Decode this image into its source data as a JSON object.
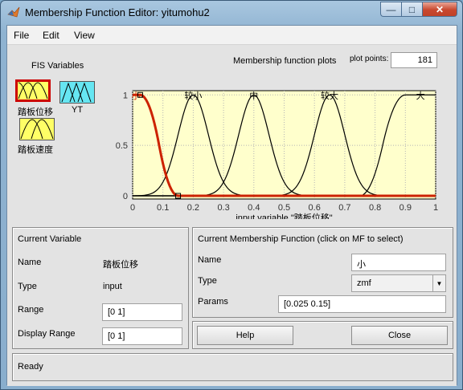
{
  "window": {
    "title": "Membership Function Editor: yitumohu2",
    "minimize_glyph": "—",
    "maximize_glyph": "□",
    "close_glyph": "✕"
  },
  "menu": [
    "File",
    "Edit",
    "View"
  ],
  "fis_variables": {
    "title": "FIS Variables",
    "inputs": [
      "踏板位移",
      "踏板速度"
    ],
    "outputs": [
      "YT"
    ],
    "selected": "踏板位移"
  },
  "plot": {
    "title": "Membership function plots",
    "plot_points_label": "plot points:",
    "plot_points_value": "181"
  },
  "chart_data": {
    "type": "line",
    "xlabel": "input variable \"踏板位移\"",
    "xlim": [
      0,
      1
    ],
    "ylim": [
      0,
      1
    ],
    "xticks": [
      "0",
      "0.1",
      "0.2",
      "0.3",
      "0.4",
      "0.5",
      "0.6",
      "0.7",
      "0.8",
      "0.9",
      "1"
    ],
    "yticks": [
      "0",
      "0.5",
      "1"
    ],
    "series": [
      {
        "name": "小",
        "type": "zmf",
        "params": [
          0.025,
          0.15
        ],
        "selected": true
      },
      {
        "name": "较小",
        "type": "gaussmf",
        "params": [
          0.05,
          0.2
        ],
        "selected": false
      },
      {
        "name": "中",
        "type": "gaussmf",
        "params": [
          0.05,
          0.4
        ],
        "selected": false
      },
      {
        "name": "较大",
        "type": "gaussmf",
        "params": [
          0.05,
          0.65
        ],
        "selected": false
      },
      {
        "name": "大",
        "type": "smf",
        "params": [
          0.75,
          0.9
        ],
        "selected": false
      }
    ],
    "colors": {
      "background": "#ffffcc",
      "selected": "#cc2200",
      "normal": "#000000"
    },
    "grid": true
  },
  "current_variable": {
    "title": "Current Variable",
    "name_label": "Name",
    "name_value": "踏板位移",
    "type_label": "Type",
    "type_value": "input",
    "range_label": "Range",
    "range_value": "[0 1]",
    "display_range_label": "Display Range",
    "display_range_value": "[0 1]"
  },
  "current_mf": {
    "title": "Current Membership Function (click on MF to select)",
    "name_label": "Name",
    "name_value": "小",
    "type_label": "Type",
    "type_value": "zmf",
    "params_label": "Params",
    "params_value": "[0.025 0.15]"
  },
  "buttons": {
    "help": "Help",
    "close": "Close"
  },
  "status": "Ready"
}
